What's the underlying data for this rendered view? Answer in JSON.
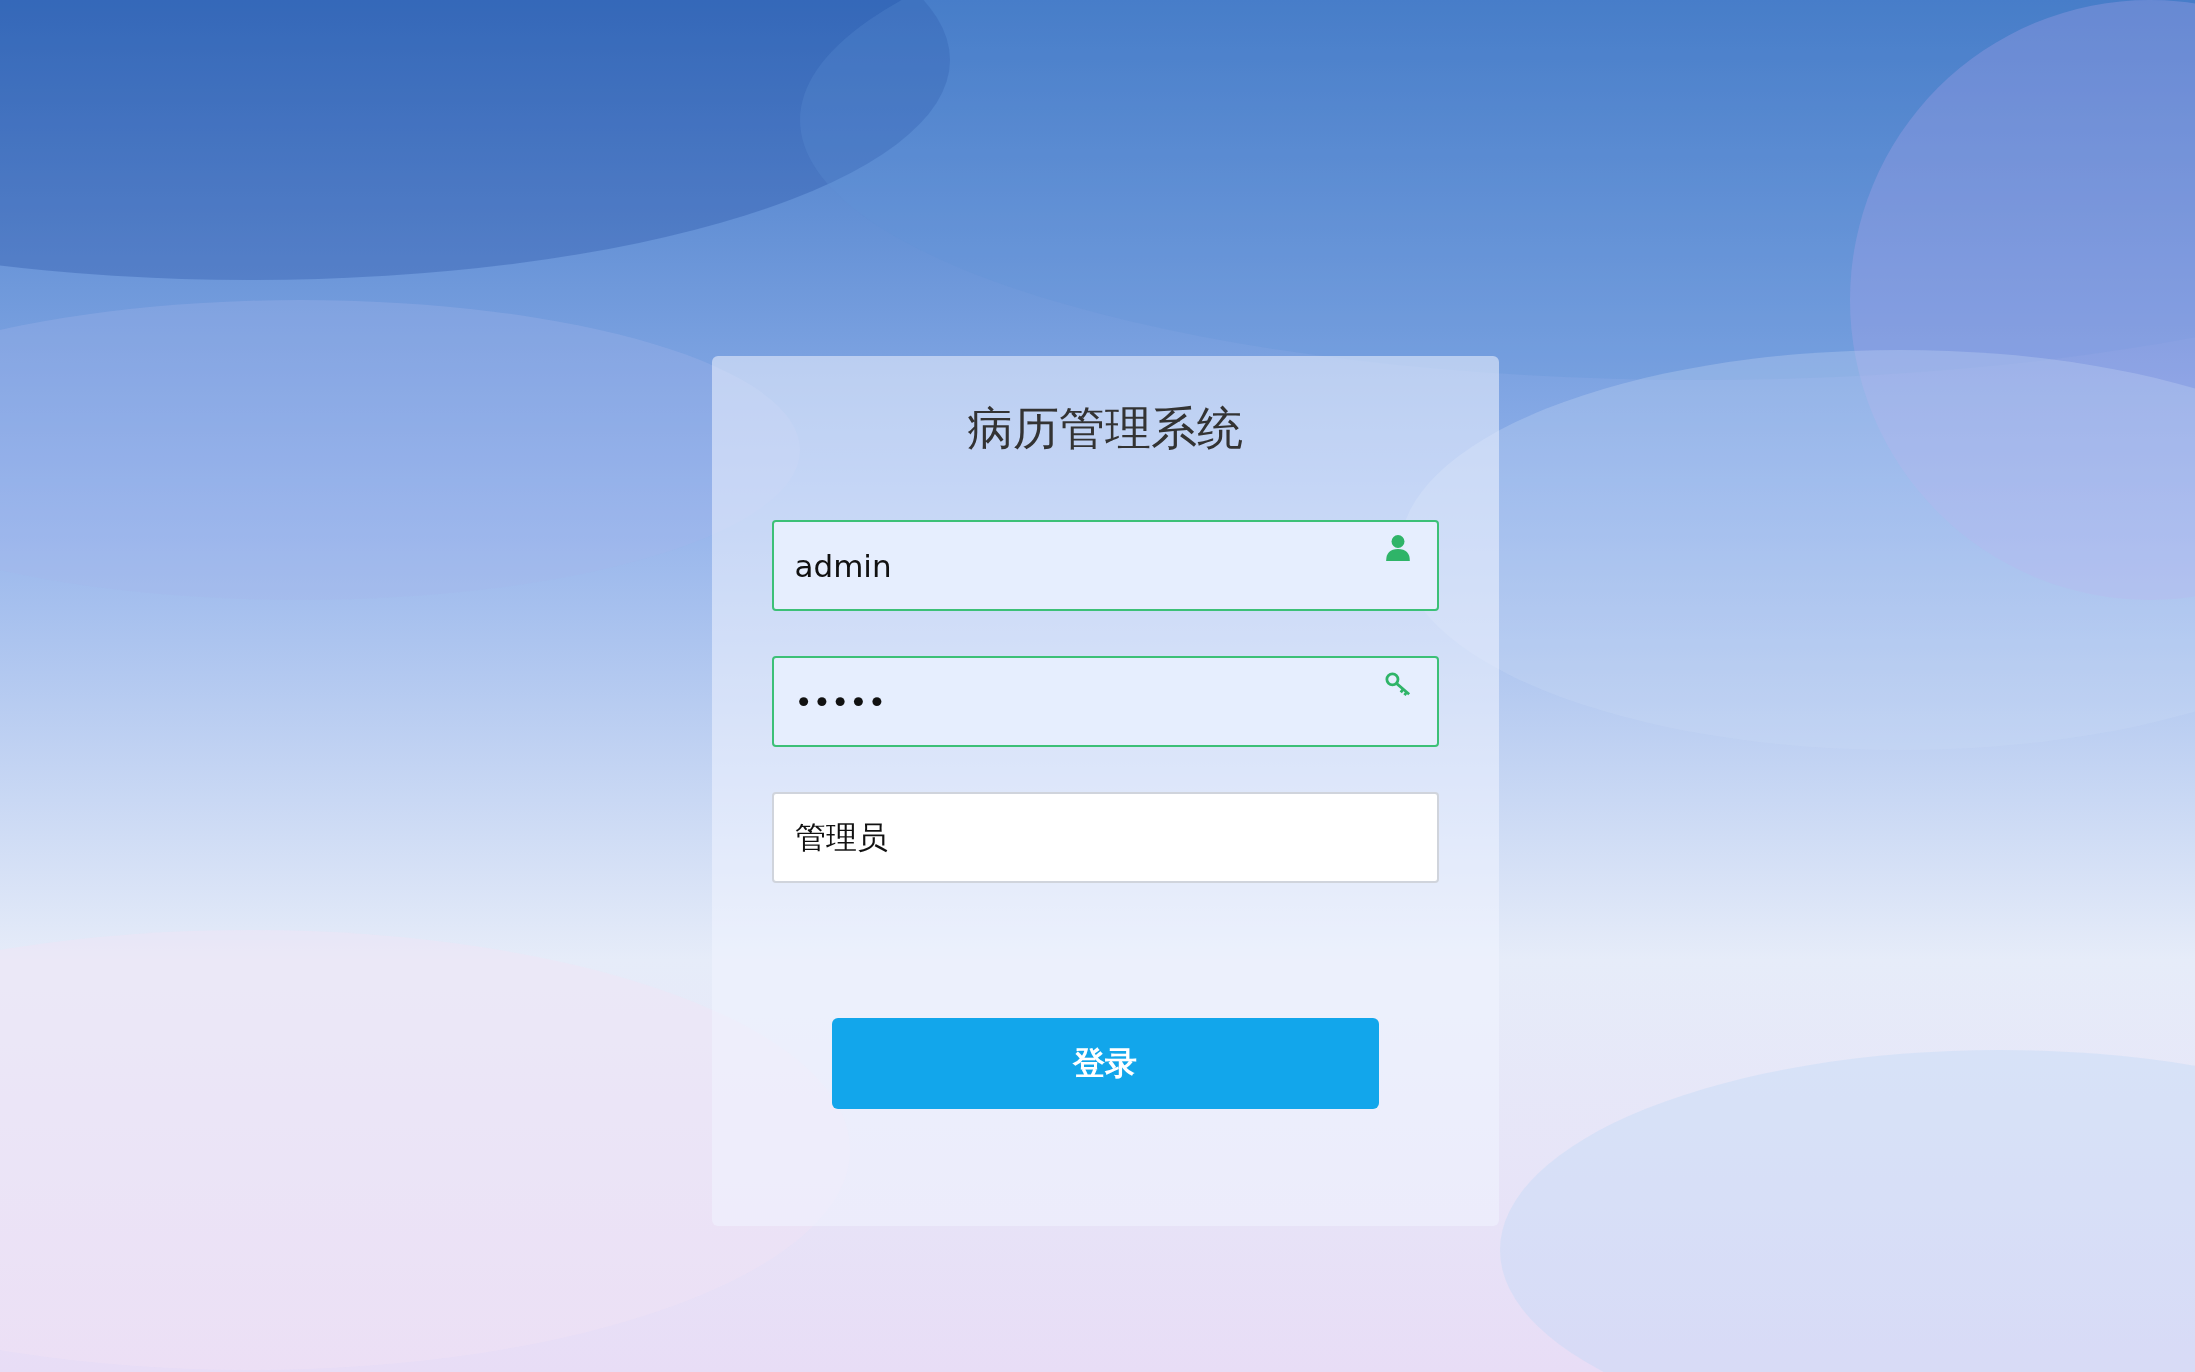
{
  "login_card": {
    "title": "病历管理系统",
    "fields": [
      {
        "kind": "text",
        "value": "admin",
        "valid": true
      },
      {
        "kind": "password",
        "value": "•••••",
        "valid": true
      },
      {
        "kind": "select",
        "value": "管理员",
        "valid": false
      }
    ],
    "submit_button": "登录"
  }
}
